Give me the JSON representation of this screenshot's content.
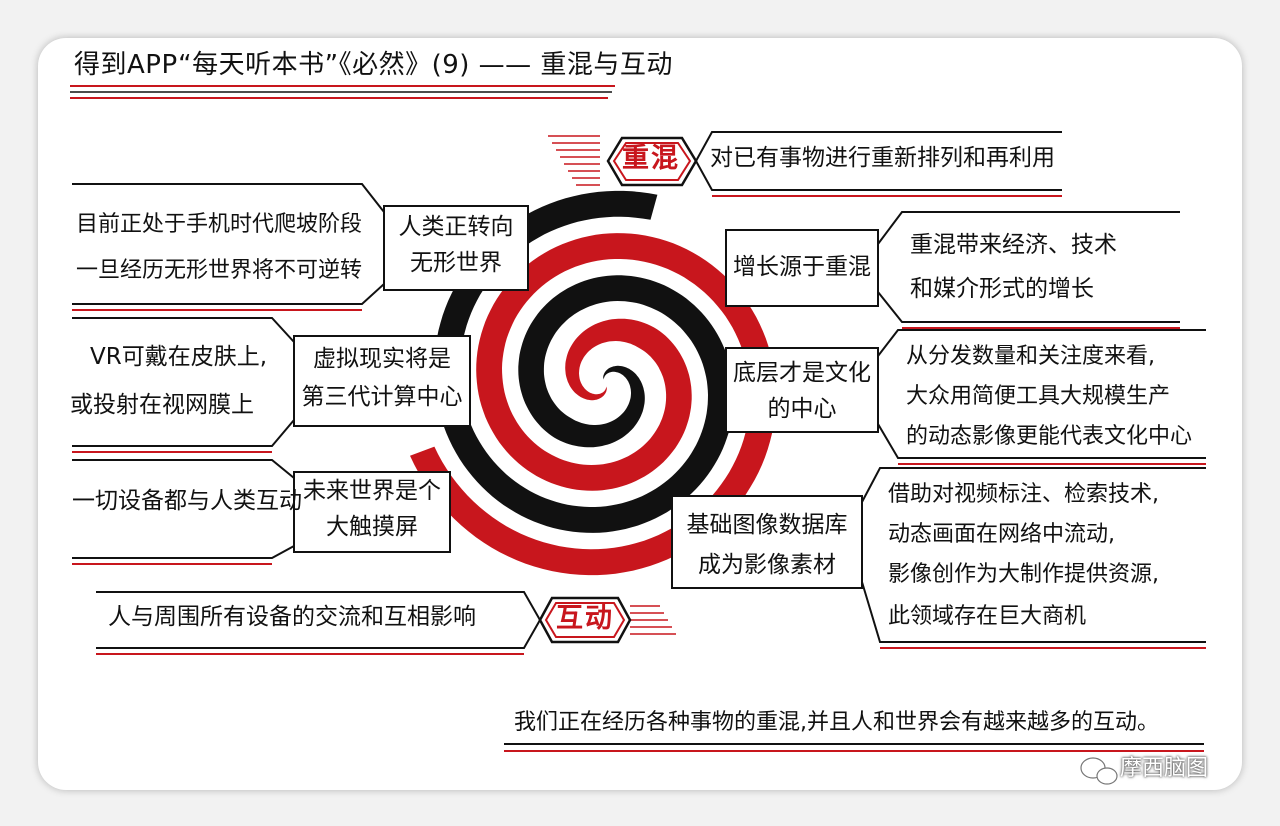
{
  "title": "得到APP“每天听本书”《必然》(9) —— 重混与互动",
  "remix": {
    "label": "重混",
    "definition": "对已有事物进行重新排列和再利用",
    "branches": [
      {
        "label": [
          "增长源于重混"
        ],
        "detail": [
          "重混带来经济、技术",
          "和媒介形式的增长"
        ]
      },
      {
        "label": [
          "底层才是文化",
          "的中心"
        ],
        "detail": [
          "从分发数量和关注度来看,",
          "大众用简便工具大规模生产",
          "的动态影像更能代表文化中心"
        ]
      },
      {
        "label": [
          "基础图像数据库",
          "成为影像素材"
        ],
        "detail": [
          "借助对视频标注、检索技术,",
          "动态画面在网络中流动,",
          "影像创作为大制作提供资源,",
          "此领域存在巨大商机"
        ]
      }
    ]
  },
  "interaction": {
    "label": "互动",
    "definition": "人与周围所有设备的交流和互相影响",
    "branches": [
      {
        "label": [
          "人类正转向",
          "无形世界"
        ],
        "detail": [
          "目前正处于手机时代爬坡阶段",
          "一旦经历无形世界将不可逆转"
        ]
      },
      {
        "label": [
          "虚拟现实将是",
          "第三代计算中心"
        ],
        "detail": [
          "VR可戴在皮肤上,",
          "或投射在视网膜上"
        ]
      },
      {
        "label": [
          "未来世界是个",
          "大触摸屏"
        ],
        "detail": [
          "一切设备都与人类互动"
        ]
      }
    ]
  },
  "conclusion": "我们正在经历各种事物的重混,并且人和世界会有越来越多的互动。",
  "watermark": "摩西脑图",
  "colors": {
    "red": "#c8161d",
    "black": "#111111"
  }
}
